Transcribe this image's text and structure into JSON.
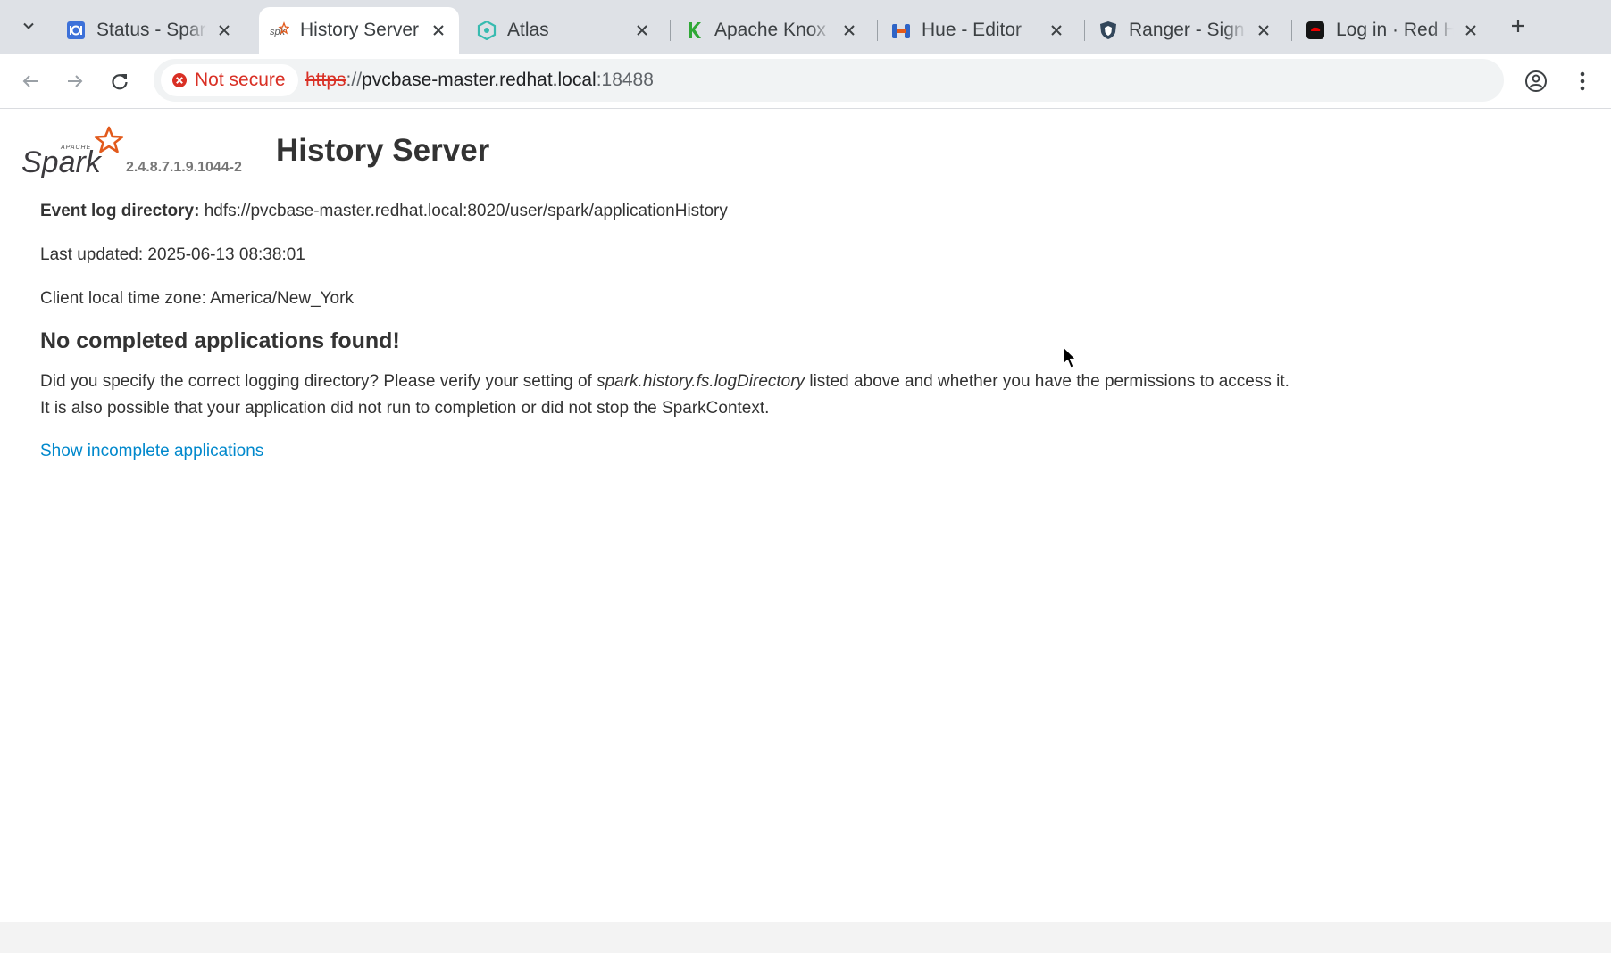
{
  "browser": {
    "tabs": [
      {
        "title": "Status - Spark",
        "icon": "grafana-icon",
        "active": false
      },
      {
        "title": "History Server",
        "icon": "spark-icon",
        "active": true
      },
      {
        "title": "Atlas",
        "icon": "atlas-icon",
        "active": false
      },
      {
        "title": "Apache Knox",
        "icon": "knox-icon",
        "active": false
      },
      {
        "title": "Hue - Editor",
        "icon": "hue-icon",
        "active": false
      },
      {
        "title": "Ranger - Sign",
        "icon": "ranger-icon",
        "active": false
      },
      {
        "title": "Log in · Red H",
        "icon": "redhat-icon",
        "active": false
      }
    ],
    "security_label": "Not secure",
    "url": {
      "scheme": "https",
      "separator": "://",
      "host": "pvcbase-master.redhat.local",
      "port": ":18488"
    }
  },
  "page": {
    "brand_text": "Spark",
    "brand_small_text": "APACHE",
    "version": "2.4.8.7.1.9.1044-2",
    "title": "History Server",
    "event_log_label": "Event log directory:",
    "event_log_value": "hdfs://pvcbase-master.redhat.local:8020/user/spark/applicationHistory",
    "last_updated": "Last updated: 2025-06-13 08:38:01",
    "timezone": "Client local time zone: America/New_York",
    "no_apps_heading": "No completed applications found!",
    "para1_before": "Did you specify the correct logging directory? Please verify your setting of ",
    "para1_italic": "spark.history.fs.logDirectory",
    "para1_after": " listed above and whether you have the permissions to access it.",
    "para2": "It is also possible that your application did not run to completion or did not stop the SparkContext.",
    "show_incomplete_link": "Show incomplete applications"
  },
  "colors": {
    "link": "#0088cc",
    "not_secure": "#d93025",
    "spark_orange": "#e25a1c"
  }
}
